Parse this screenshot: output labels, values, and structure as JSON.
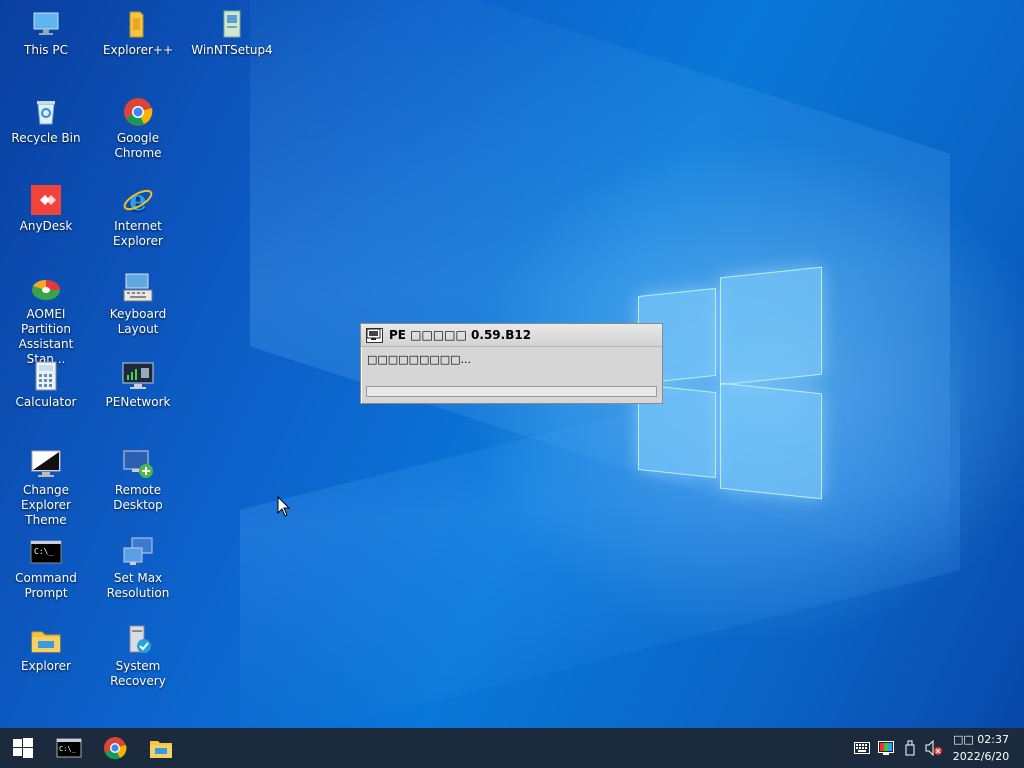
{
  "desktop": {
    "icons": [
      {
        "label": "This PC",
        "icon": "this-pc-icon"
      },
      {
        "label": "Explorer++",
        "icon": "folder-icon"
      },
      {
        "label": "WinNTSetup4",
        "icon": "winntsetup-icon"
      },
      {
        "label": "Recycle Bin",
        "icon": "recycle-bin-icon"
      },
      {
        "label": "Google Chrome",
        "icon": "chrome-icon"
      },
      {
        "label": "AnyDesk",
        "icon": "anydesk-icon"
      },
      {
        "label": "Internet Explorer",
        "icon": "ie-icon"
      },
      {
        "label": "AOMEI Partition Assistant Stan...",
        "icon": "aomei-icon"
      },
      {
        "label": "Keyboard Layout",
        "icon": "keyboard-icon"
      },
      {
        "label": "Calculator",
        "icon": "calculator-icon"
      },
      {
        "label": "PENetwork",
        "icon": "network-icon"
      },
      {
        "label": "Change Explorer Theme",
        "icon": "theme-icon"
      },
      {
        "label": "Remote Desktop",
        "icon": "remote-desktop-icon"
      },
      {
        "label": "Command Prompt",
        "icon": "cmd-icon"
      },
      {
        "label": "Set Max Resolution",
        "icon": "resolution-icon"
      },
      {
        "label": "Explorer",
        "icon": "explorer-folder-icon"
      },
      {
        "label": "System Recovery",
        "icon": "system-recovery-icon"
      }
    ]
  },
  "dialog": {
    "title": "PE □□□□□ 0.59.B12",
    "message": "□□□□□□□□□...",
    "progress": 0.0
  },
  "taskbar": {
    "start": "windows-logo-icon",
    "pinned": [
      "cmd-icon",
      "chrome-icon",
      "file-explorer-icon"
    ],
    "tray": [
      "keyboard-icon",
      "color-icon",
      "usb-icon",
      "volume-muted-icon"
    ],
    "time": "□□ 02:37",
    "date": "2022/6/20"
  },
  "colors": {
    "taskbar": "#1b2a3c",
    "wallpaper": "#0a78d8",
    "dialog": "#d6d6d6"
  }
}
